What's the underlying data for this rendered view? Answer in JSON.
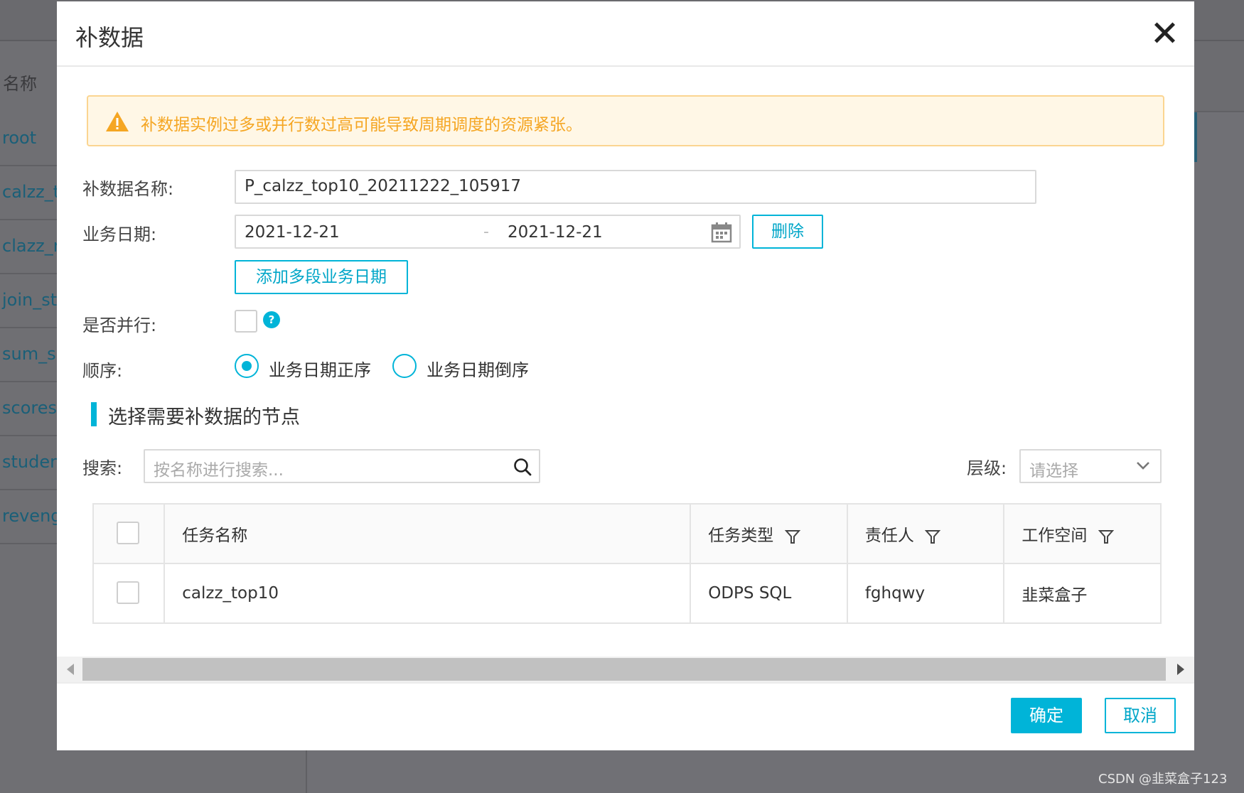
{
  "background": {
    "list_header": "名称",
    "rows": [
      "root",
      "calzz_t",
      "clazz_r",
      "join_stu",
      "sum_sc",
      "scores",
      "student",
      "revenge"
    ]
  },
  "modal": {
    "title": "补数据",
    "alert_text": "补数据实例过多或并行数过高可能导致周期调度的资源紧张。",
    "fields": {
      "name_label": "补数据名称:",
      "name_value": "P_calzz_top10_20211222_105917",
      "date_label": "业务日期:",
      "date_start": "2021-12-21",
      "date_separator": "-",
      "date_end": "2021-12-21",
      "delete_label": "删除",
      "add_range_label": "添加多段业务日期",
      "parallel_label": "是否并行:",
      "help_glyph": "?",
      "order_label": "顺序:",
      "order_options": [
        {
          "label": "业务日期正序",
          "checked": true
        },
        {
          "label": "业务日期倒序",
          "checked": false
        }
      ]
    },
    "section_title": "选择需要补数据的节点",
    "search": {
      "label": "搜索:",
      "placeholder": "按名称进行搜索..."
    },
    "level": {
      "label": "层级:",
      "placeholder": "请选择"
    },
    "table": {
      "columns": [
        "任务名称",
        "任务类型",
        "责任人",
        "工作空间"
      ],
      "rows": [
        {
          "name": "calzz_top10",
          "type": "ODPS SQL",
          "owner": "fghqwy",
          "workspace": "韭菜盒子"
        }
      ]
    },
    "buttons": {
      "ok": "确定",
      "cancel": "取消"
    }
  },
  "watermark": "CSDN @韭菜盒子123",
  "colors": {
    "accent": "#00b4d8",
    "warning": "#f5a623",
    "warning_bg": "#fff7e6"
  }
}
